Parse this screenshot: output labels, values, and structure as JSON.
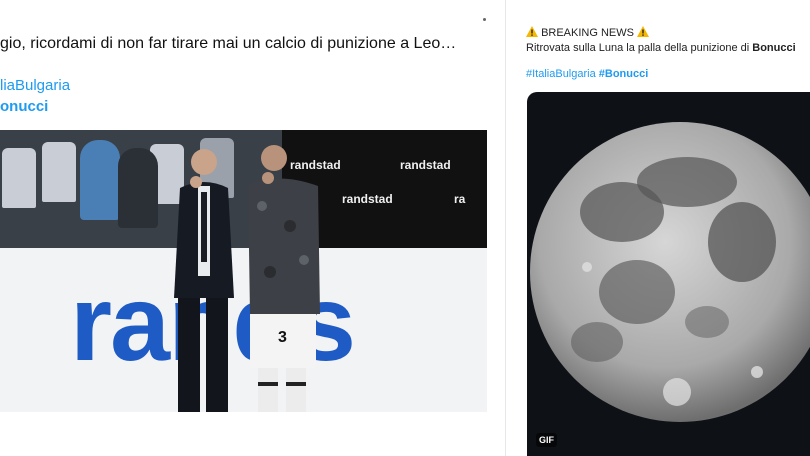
{
  "left_tweet": {
    "text": "gio, ricordami di non far tirare mai un calcio di punizione a Leo…",
    "hashtag1": "liaBulgaria",
    "hashtag2": "onucci",
    "photo": {
      "board_texts": [
        "randstad",
        "randstad",
        "randstad",
        "ra"
      ],
      "ad_text": "rands",
      "shirt_number": "3"
    }
  },
  "right_tweet": {
    "breaking": "BREAKING NEWS",
    "text_prefix": "Ritrovata sulla Luna la palla della punizione di ",
    "text_bold": "Bonucci",
    "hashtag1": "#ItaliaBulgaria",
    "hashtag2": "#Bonucci",
    "gif_badge": "GIF"
  },
  "colors": {
    "link": "#1d9bf0",
    "ad_blue": "#1f5bc4",
    "warning": "#f5b700"
  }
}
